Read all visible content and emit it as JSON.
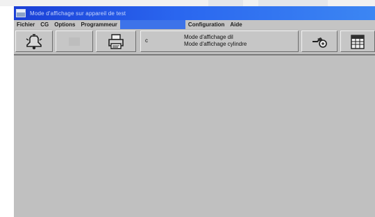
{
  "titlebar": {
    "title": "Mode d'affichage sur appareil de test"
  },
  "menu": {
    "items": [
      {
        "label": "Fichier"
      },
      {
        "label": "CG"
      },
      {
        "label": "Options"
      },
      {
        "label": "Programmeur"
      },
      {
        "label": "",
        "active": true
      },
      {
        "label": "Configuration"
      },
      {
        "label": "Aide"
      }
    ]
  },
  "toolbar": {
    "buttons": [
      {
        "icon": "alarm-bell-icon"
      },
      {
        "icon": "blank-icon"
      },
      {
        "icon": "printer-icon"
      },
      {
        "icon": "connection-icon"
      },
      {
        "icon": "calendar-icon"
      }
    ],
    "mode": {
      "prefix": "c",
      "line1": "Mode d'affichage dil",
      "line2": "Mode d'affichage cylindre"
    }
  },
  "colors": {
    "titlebar": "#2a66ef",
    "face": "#c0c0c0",
    "menu_highlight": "#3d73e9"
  }
}
